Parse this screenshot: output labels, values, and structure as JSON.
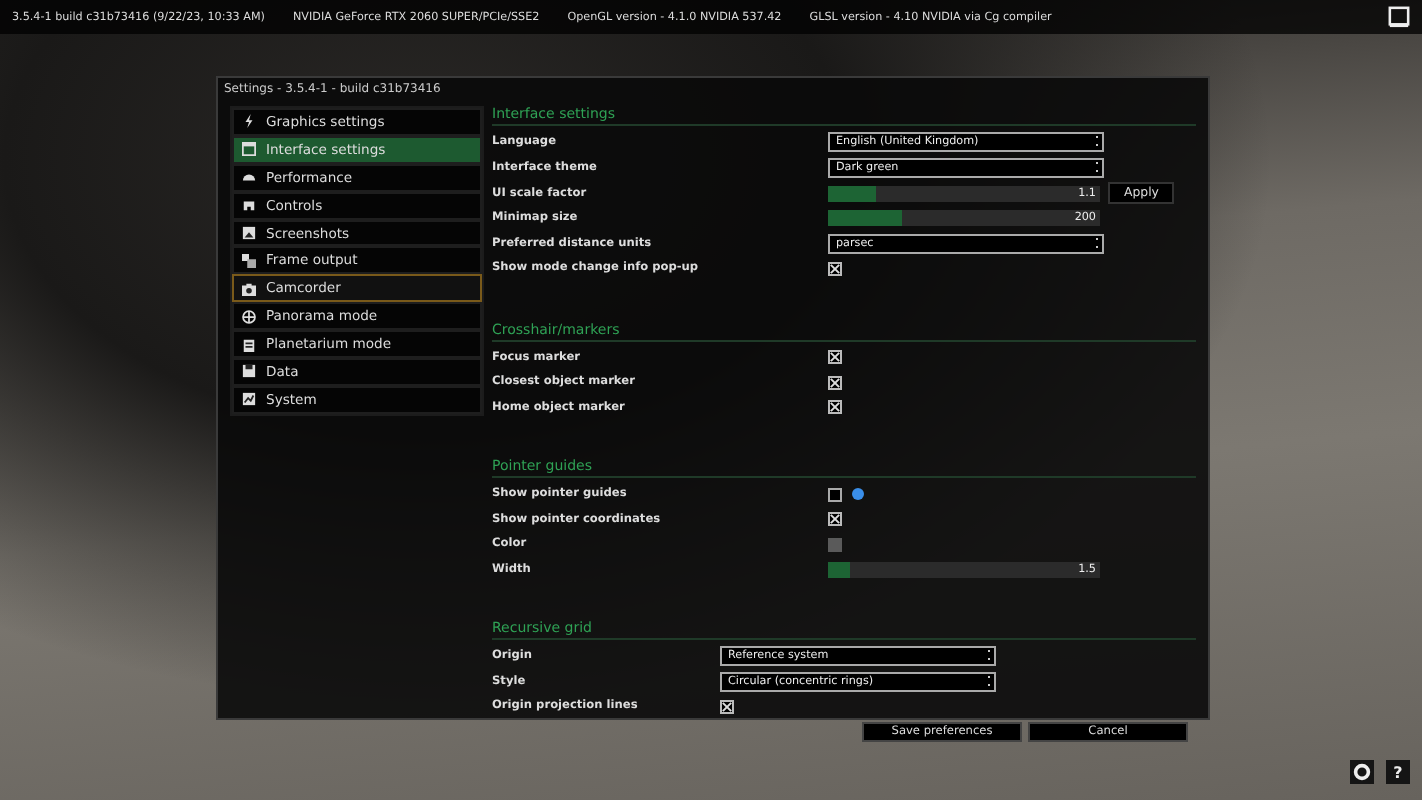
{
  "top_bar": {
    "items": [
      "3.5.4-1  build c31b73416 (9/22/23, 10:33 AM)",
      "NVIDIA GeForce RTX 2060 SUPER/PCIe/SSE2",
      "OpenGL version - 4.1.0 NVIDIA 537.42",
      "GLSL version - 4.10 NVIDIA via Cg compiler"
    ]
  },
  "dialog": {
    "title": "Settings - 3.5.4-1 - build c31b73416",
    "sidebar": {
      "items": [
        {
          "label": "Graphics settings",
          "selected": false,
          "focused": false
        },
        {
          "label": "Interface settings",
          "selected": true,
          "focused": false
        },
        {
          "label": "Performance",
          "selected": false,
          "focused": false
        },
        {
          "label": "Controls",
          "selected": false,
          "focused": false
        },
        {
          "label": "Screenshots",
          "selected": false,
          "focused": false
        },
        {
          "label": "Frame output",
          "selected": false,
          "focused": false
        },
        {
          "label": "Camcorder",
          "selected": false,
          "focused": true
        },
        {
          "label": "Panorama mode",
          "selected": false,
          "focused": false
        },
        {
          "label": "Planetarium mode",
          "selected": false,
          "focused": false
        },
        {
          "label": "Data",
          "selected": false,
          "focused": false
        },
        {
          "label": "System",
          "selected": false,
          "focused": false
        }
      ]
    },
    "sections": [
      {
        "title": "Interface settings",
        "rows": [
          {
            "kind": "select",
            "label": "Language",
            "value": "English (United Kingdom)"
          },
          {
            "kind": "select",
            "label": "Interface theme",
            "value": "Dark green"
          },
          {
            "kind": "slider",
            "label": "UI scale factor",
            "level": 0.18,
            "reading": "1.1",
            "button": "Apply"
          },
          {
            "kind": "slider",
            "label": "Minimap size",
            "level": 0.27,
            "reading": "200"
          },
          {
            "kind": "select",
            "label": "Preferred distance units",
            "value": "parsec"
          },
          {
            "kind": "checkbox",
            "label": "Show mode change info pop-up",
            "checked": true
          }
        ]
      },
      {
        "title": "Crosshair/markers",
        "rows": [
          {
            "kind": "checkbox",
            "label": "Focus marker",
            "checked": true
          },
          {
            "kind": "checkbox",
            "label": "Closest object marker",
            "checked": true
          },
          {
            "kind": "checkbox",
            "label": "Home object marker",
            "checked": true
          }
        ]
      },
      {
        "title": "Pointer guides",
        "rows": [
          {
            "kind": "checkbox",
            "label": "Show pointer guides",
            "checked": false,
            "help_icon": true
          },
          {
            "kind": "checkbox",
            "label": "Show pointer coordinates",
            "checked": true
          },
          {
            "kind": "swatch",
            "label": "Color"
          },
          {
            "kind": "slider",
            "label": "Width",
            "level": 0.08,
            "reading": "1.5"
          }
        ]
      },
      {
        "title": "Recursive grid",
        "rows": [
          {
            "kind": "select",
            "label": "Origin",
            "value": "Reference system"
          },
          {
            "kind": "select",
            "label": "Style",
            "value": "Circular (concentric rings)"
          },
          {
            "kind": "checkbox",
            "label": "Origin projection lines",
            "checked": true
          }
        ]
      }
    ],
    "buttons": [
      "Save preferences",
      "Cancel"
    ]
  },
  "help_button": "?"
}
